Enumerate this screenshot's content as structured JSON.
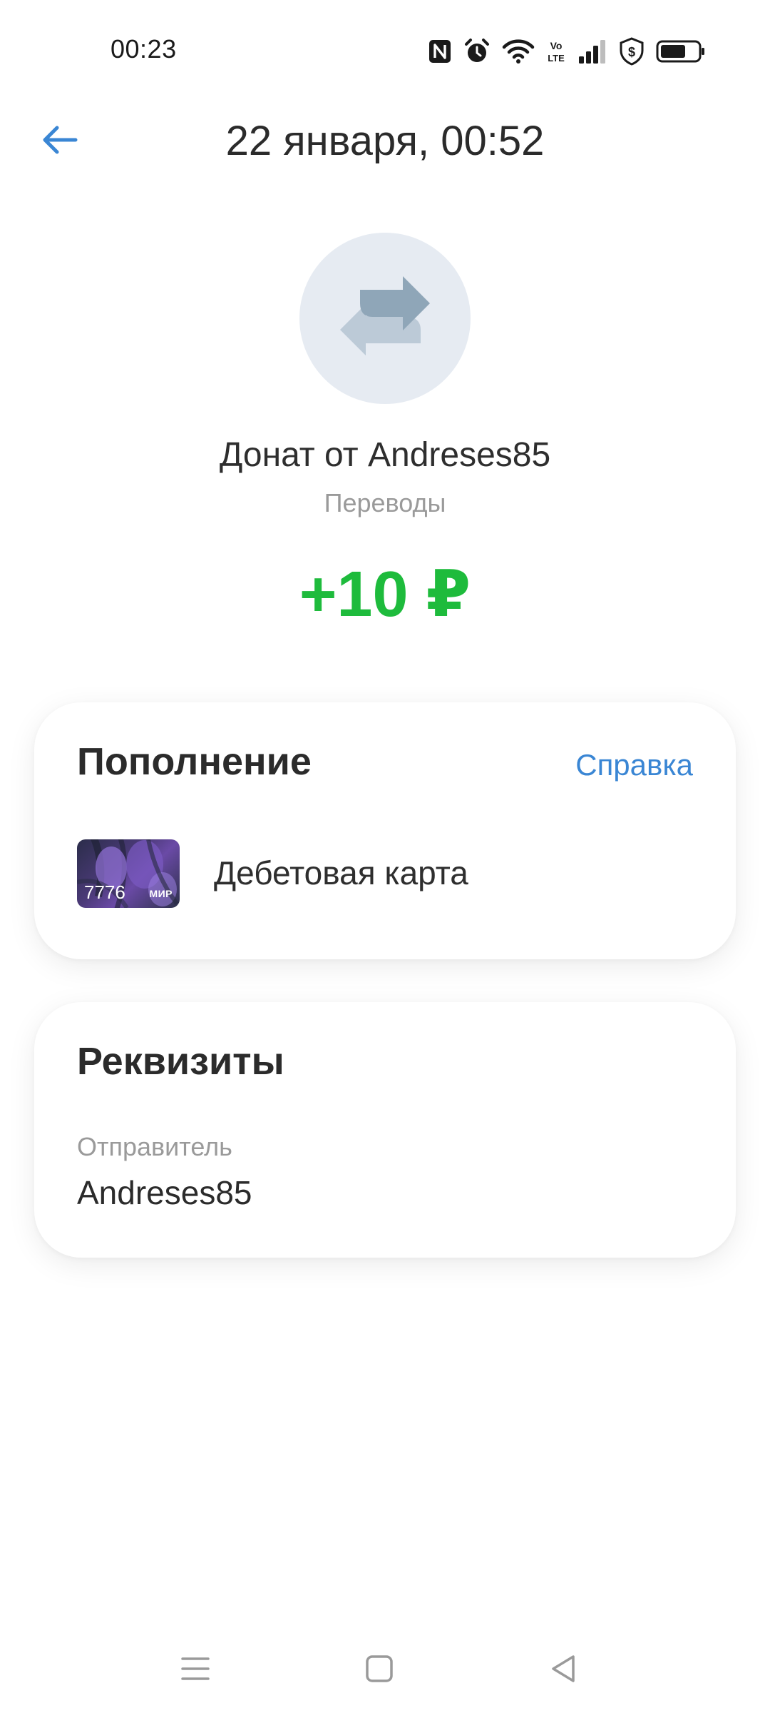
{
  "status_bar": {
    "time": "00:23",
    "icons": [
      "nfc-icon",
      "alarm-icon",
      "wifi-icon",
      "volte-icon",
      "signal-icon",
      "shield-icon",
      "battery-icon"
    ],
    "volte_text": "Vo LTE"
  },
  "header": {
    "title": "22 января, 00:52",
    "back_icon": "arrow-left-icon"
  },
  "operation": {
    "icon": "transfer-arrows-icon",
    "title": "Донат от Andreses85",
    "category": "Переводы",
    "amount": "+10 ₽"
  },
  "topup_card": {
    "title": "Пополнение",
    "help_label": "Справка",
    "account": {
      "card_digits": "7776",
      "card_brand": "МИР",
      "label": "Дебетовая карта"
    }
  },
  "details_card": {
    "title": "Реквизиты",
    "sender_label": "Отправитель",
    "sender_value": "Andreses85"
  },
  "nav_bar": {
    "icons": [
      "menu-icon",
      "home-square-icon",
      "back-triangle-icon"
    ]
  },
  "colors": {
    "accent": "#3a86d4",
    "amount_positive": "#1ebb3c",
    "avatar_bg": "#e6ebf2",
    "text_primary": "#2b2b2b",
    "text_secondary": "#9a9a9a"
  }
}
